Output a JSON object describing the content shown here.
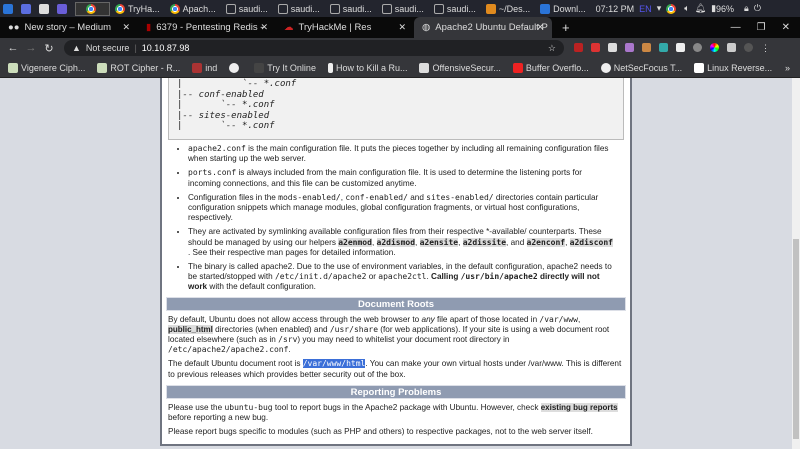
{
  "taskbar": {
    "items": [
      "TryHa...",
      "Apach...",
      "saudi...",
      "saudi...",
      "saudi...",
      "saudi...",
      "saudi...",
      "~/Des...",
      "Downl..."
    ],
    "time": "07:12 PM",
    "lang": "EN",
    "battery": "96%"
  },
  "tabs": [
    {
      "label": "New story – Medium"
    },
    {
      "label": "6379 - Pentesting Redis -"
    },
    {
      "label": "TryHackMe | Res"
    },
    {
      "label": "Apache2 Ubuntu Default P",
      "active": true
    }
  ],
  "address": {
    "security": "Not secure",
    "url": "10.10.87.98"
  },
  "bookmarks": [
    "Vigenere Ciph...",
    "ROT Cipher - R...",
    "ind",
    "",
    "Try It Online",
    "How to Kill a Ru...",
    "OffensiveSecur...",
    "Buffer Overflo...",
    "NetSecFocus T...",
    "Linux Reverse..."
  ],
  "content": {
    "tree": [
      "|           `-- *.conf",
      "|-- conf-enabled",
      "|       `-- *.conf",
      "|-- sites-enabled",
      "|       `-- *.conf"
    ],
    "li1": {
      "code": "apache2.conf",
      "text": " is the main configuration file. It puts the pieces together by including all remaining configuration files when starting up the web server."
    },
    "li2": {
      "code": "ports.conf",
      "text": " is always included from the main configuration file. It is used to determine the listening ports for incoming connections, and this file can be customized anytime."
    },
    "li3": {
      "t1": "Configuration files in the ",
      "c1": "mods-enabled/",
      "t2": ", ",
      "c2": "conf-enabled/",
      "t3": " and ",
      "c3": "sites-enabled/",
      "t4": " directories contain particular configuration snippets which manage modules, global configuration fragments, or virtual host configurations, respectively."
    },
    "li4": {
      "t1": "They are activated by symlinking available configuration files from their respective *-available/ counterparts. These should be managed by using our helpers ",
      "h1": "a2enmod",
      "h2": "a2dismod",
      "h3": "a2ensite",
      "h4": "a2dissite",
      "and": ", and ",
      "h5": "a2enconf",
      "h6": "a2disconf",
      "t2": " . See their respective man pages for detailed information."
    },
    "li5": {
      "t1": "The binary is called apache2. Due to the use of environment variables, in the default configuration, apache2 needs to be started/stopped with ",
      "c1": "/etc/init.d/apache2",
      "t2": " or ",
      "c2": "apache2ctl",
      "t3": ". ",
      "b1": "Calling ",
      "bc": "/usr/bin/apache2",
      "b2": " directly will not work",
      "t4": " with the default configuration."
    },
    "doc_roots_title": "Document Roots",
    "dr1": {
      "t1": "By default, Ubuntu does not allow access through the web browser to ",
      "em": "any",
      "t2": " file apart of those located in ",
      "c1": "/var/www",
      "t3": ", ",
      "b": "public_html",
      "t4": " directories (when enabled) and ",
      "c2": "/usr/share",
      "t5": " (for web applications). If your site is using a web document root located elsewhere (such as in ",
      "c3": "/srv",
      "t6": ") you may need to whitelist your document root directory in ",
      "c4": "/etc/apache2/apache2.conf",
      "t7": "."
    },
    "dr2": {
      "t1": "The default Ubuntu document root is ",
      "hl": "/var/www/html",
      "t2": ". You can make your own virtual hosts under /var/www. This is different to previous releases which provides better security out of the box."
    },
    "reporting_title": "Reporting Problems",
    "rp1": {
      "t1": "Please use the ",
      "c": "ubuntu-bug",
      "t2": " tool to report bugs in the Apache2 package with Ubuntu. However, check ",
      "link": "existing bug reports",
      "t3": " before reporting a new bug."
    },
    "rp2": "Please report bugs specific to modules (such as PHP and others) to respective packages, not to the web server itself."
  },
  "scroll_position_percent": 100
}
